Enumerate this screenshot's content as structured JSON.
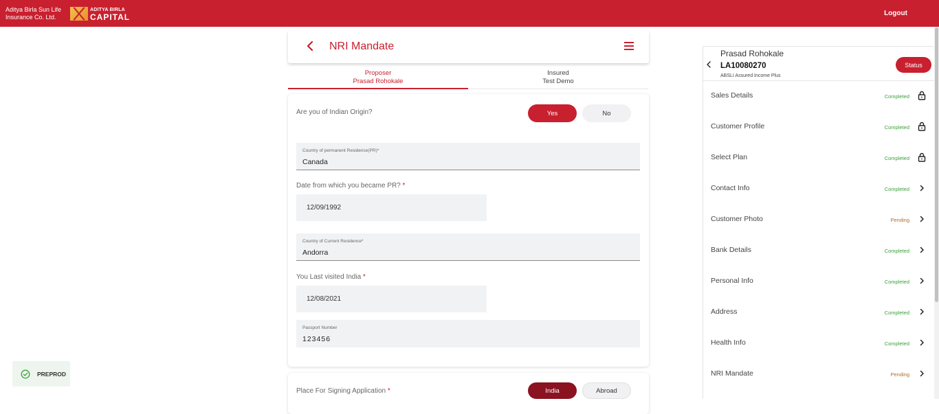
{
  "header": {
    "brand_company": "Aditya Birla Sun Life Insurance Co. Ltd.",
    "brand_logo_top": "ADITYA BIRLA",
    "brand_logo_bottom": "CAPITAL",
    "logout_label": "Logout"
  },
  "page": {
    "title": "NRI Mandate",
    "back_icon": "chevron-left-icon",
    "menu_icon": "hamburger-menu-icon"
  },
  "tabs": [
    {
      "role": "Proposer",
      "name": "Prasad Rohokale",
      "active": true
    },
    {
      "role": "Insured",
      "name": "Test Demo",
      "active": false
    }
  ],
  "form": {
    "indian_origin_question": "Are you of Indian Origin?",
    "yes_label": "Yes",
    "no_label": "No",
    "pr_country_label": "Country of permanent Residence(PR)*",
    "pr_country_value": "Canada",
    "pr_date_label": "Date from which you became PR?",
    "pr_date_value": "12/09/1992",
    "current_country_label": "Country of Current Residence*",
    "current_country_value": "Andorra",
    "last_visit_label": "You Last visited India",
    "last_visit_value": "12/08/2021",
    "passport_label": "Passport Number",
    "passport_value": "123456",
    "required_mark": "*"
  },
  "signing": {
    "label": "Place For Signing Application",
    "india_label": "India",
    "abroad_label": "Abroad"
  },
  "env_badge": {
    "label": "PREPROD",
    "icon": "check-circle-icon"
  },
  "sidebar": {
    "name": "Prasad Rohokale",
    "application_id": "LA10080270",
    "plan": "ABSLI Assured Income Plus",
    "status_label": "Status",
    "items": [
      {
        "label": "Sales Details",
        "status": "Completed",
        "icon": "lock-icon"
      },
      {
        "label": "Customer Profile",
        "status": "Completed",
        "icon": "lock-icon"
      },
      {
        "label": "Select Plan",
        "status": "Completed",
        "icon": "lock-icon"
      },
      {
        "label": "Contact Info",
        "status": "Completed",
        "icon": "chevron-right-icon"
      },
      {
        "label": "Customer Photo",
        "status": "Pending",
        "icon": "chevron-right-icon"
      },
      {
        "label": "Bank Details",
        "status": "Completed",
        "icon": "chevron-right-icon"
      },
      {
        "label": "Personal Info",
        "status": "Completed",
        "icon": "chevron-right-icon"
      },
      {
        "label": "Address",
        "status": "Completed",
        "icon": "chevron-right-icon"
      },
      {
        "label": "Health Info",
        "status": "Completed",
        "icon": "chevron-right-icon"
      },
      {
        "label": "NRI Mandate",
        "status": "Pending",
        "icon": "chevron-right-icon"
      }
    ]
  },
  "colors": {
    "brand_red": "#c8202f",
    "dark_red": "#8b1220",
    "completed_green": "#3aa13a",
    "pending_brown": "#b56a2a"
  }
}
